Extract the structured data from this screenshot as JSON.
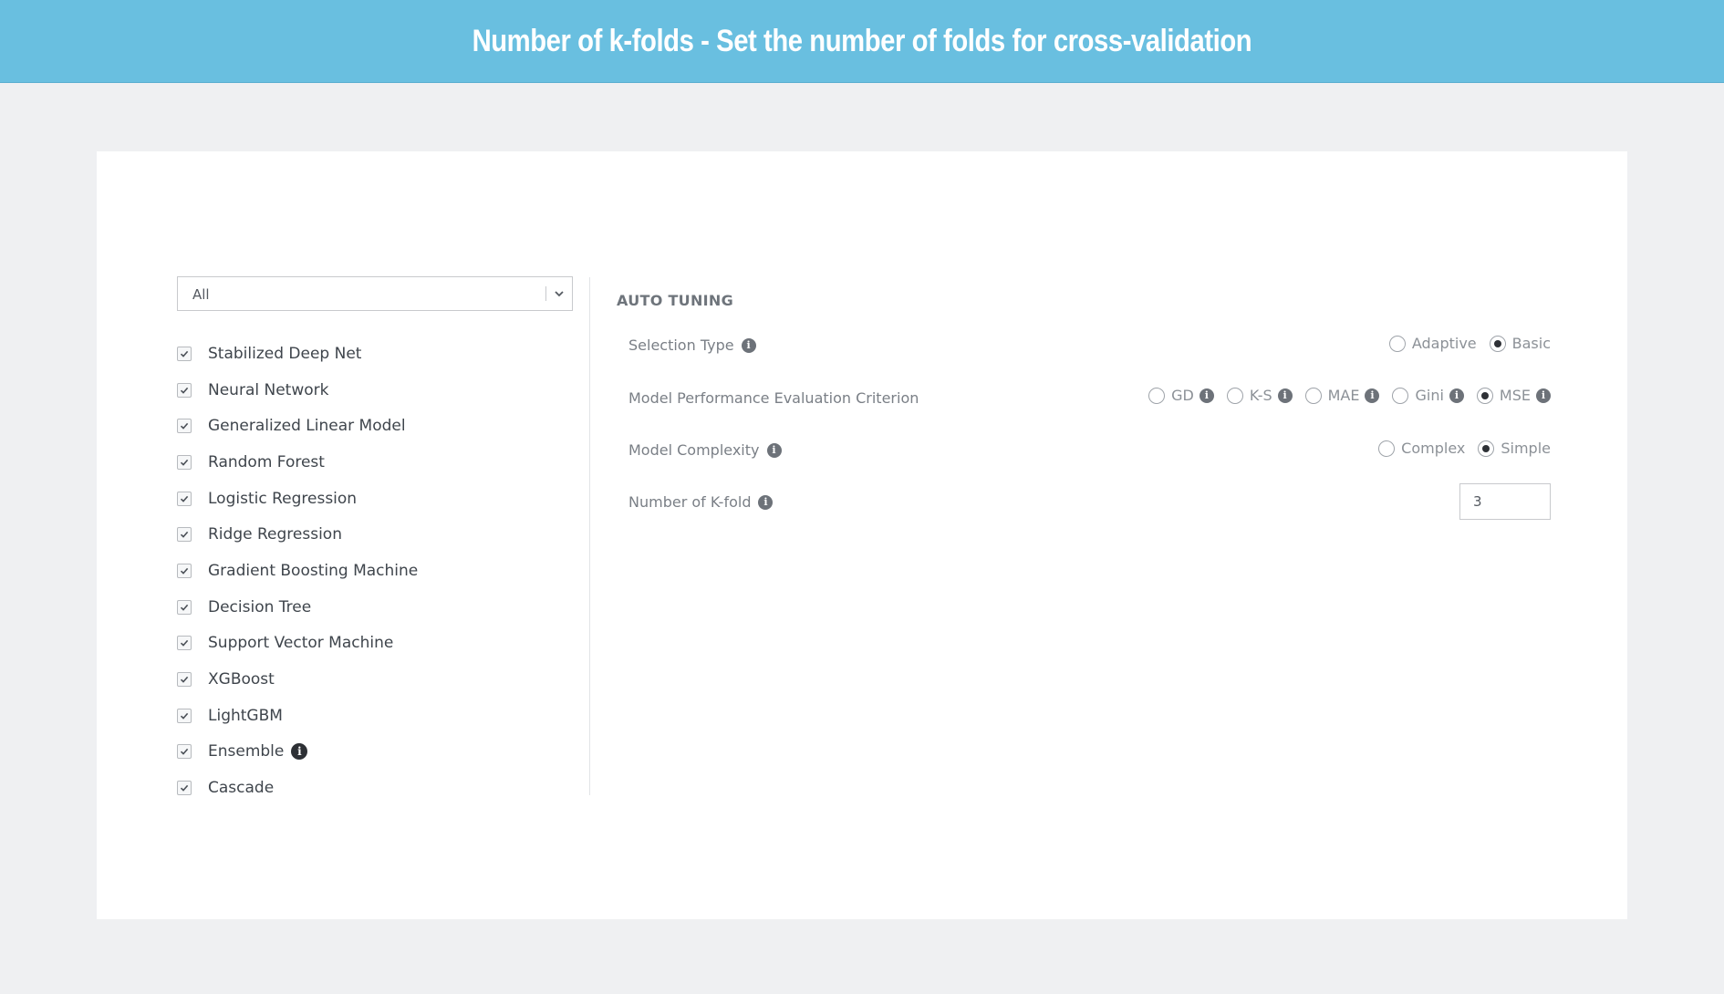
{
  "banner": {
    "title": "Number of k-folds - Set the number of folds for cross-validation"
  },
  "model_filter": {
    "selected": "All"
  },
  "models": [
    {
      "label": "Stabilized Deep Net",
      "checked": true
    },
    {
      "label": "Neural Network",
      "checked": true
    },
    {
      "label": "Generalized Linear Model",
      "checked": true
    },
    {
      "label": "Random Forest",
      "checked": true
    },
    {
      "label": "Logistic Regression",
      "checked": true
    },
    {
      "label": "Ridge Regression",
      "checked": true
    },
    {
      "label": "Gradient Boosting Machine",
      "checked": true
    },
    {
      "label": "Decision Tree",
      "checked": true
    },
    {
      "label": "Support Vector Machine",
      "checked": true
    },
    {
      "label": "XGBoost",
      "checked": true
    },
    {
      "label": "LightGBM",
      "checked": true
    },
    {
      "label": "Ensemble",
      "checked": true,
      "info": true
    },
    {
      "label": "Cascade",
      "checked": true
    }
  ],
  "auto_tuning": {
    "title": "AUTO TUNING",
    "selection_type": {
      "label": "Selection Type",
      "options": [
        {
          "label": "Adaptive",
          "selected": false
        },
        {
          "label": "Basic",
          "selected": true
        }
      ]
    },
    "evaluation_criterion": {
      "label": "Model Performance Evaluation Criterion",
      "options": [
        {
          "label": "GD",
          "selected": false
        },
        {
          "label": "K-S",
          "selected": false
        },
        {
          "label": "MAE",
          "selected": false
        },
        {
          "label": "Gini",
          "selected": false
        },
        {
          "label": "MSE",
          "selected": true
        }
      ]
    },
    "model_complexity": {
      "label": "Model Complexity",
      "options": [
        {
          "label": "Complex",
          "selected": false
        },
        {
          "label": "Simple",
          "selected": true
        }
      ]
    },
    "kfold": {
      "label": "Number of K-fold",
      "value": "3"
    }
  },
  "icons": {
    "info": "info-icon",
    "checkbox": "checkmark-icon",
    "dropdown": "chevron-down-icon"
  }
}
